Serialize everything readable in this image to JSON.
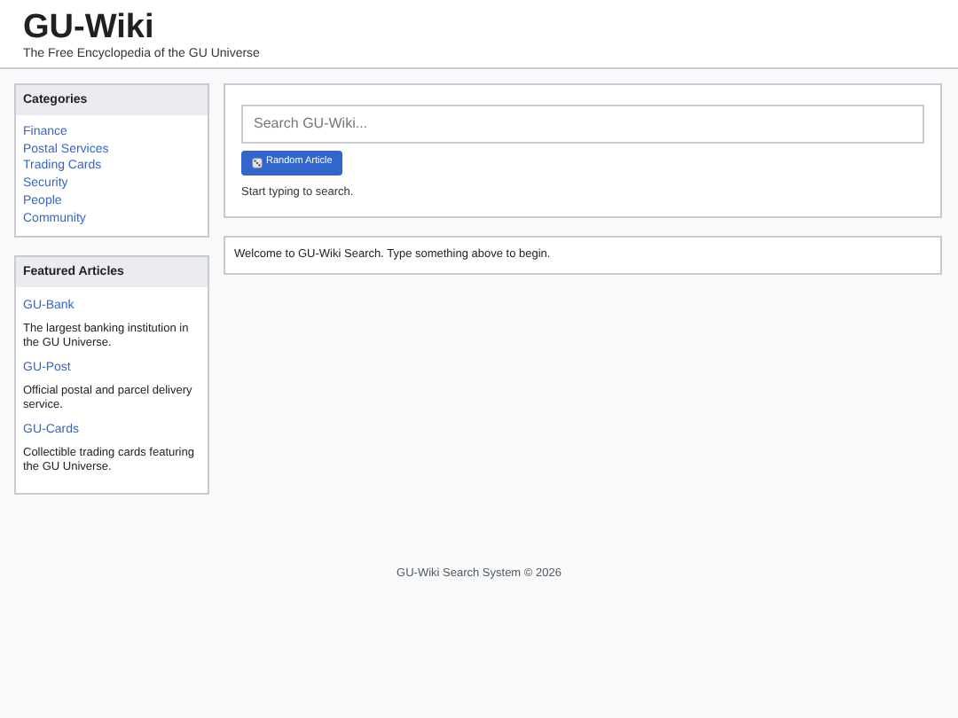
{
  "header": {
    "title": "GU-Wiki",
    "subtitle": "The Free Encyclopedia of the GU Universe"
  },
  "categories": {
    "heading": "Categories",
    "items": [
      "Finance",
      "Postal Services",
      "Trading Cards",
      "Security",
      "People",
      "Community"
    ]
  },
  "featured": {
    "heading": "Featured Articles",
    "articles": [
      {
        "title": "GU-Bank",
        "description": "The largest banking institution in the GU Universe."
      },
      {
        "title": "GU-Post",
        "description": "Official postal and parcel delivery service."
      },
      {
        "title": "GU-Cards",
        "description": "Collectible trading cards featuring the GU Universe."
      }
    ]
  },
  "search": {
    "placeholder": "Search GU-Wiki...",
    "button": "Random Article",
    "status": "Start typing to search."
  },
  "results": {
    "message": "Welcome to GU-Wiki Search. Type something above to begin."
  },
  "footer": "GU-Wiki Search System © 2026"
}
